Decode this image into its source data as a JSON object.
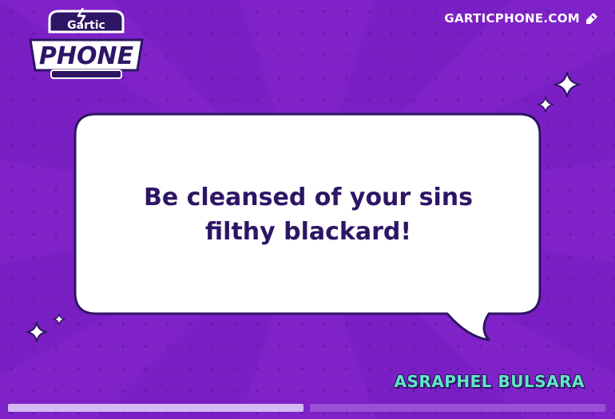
{
  "brand": {
    "logo_top": "Gartic",
    "logo_bottom": "PHONE",
    "site_link": "GARTICPHONE.COM"
  },
  "icons": {
    "site_link_icon": "edit-pencil-icon",
    "sparkles": "sparkle-icon"
  },
  "round": {
    "message": "Be cleansed of your sins filthy blackard!",
    "author": "ASRAPHEL BULSARA"
  },
  "progress": {
    "segments": [
      {
        "state": "done"
      },
      {
        "state": "todo"
      }
    ]
  },
  "colors": {
    "background": "#7a1fc4",
    "dots": "#6a16b0",
    "bubble_fill": "#ffffff",
    "bubble_outline": "#2e1565",
    "text": "#2e1565",
    "author": "#62e6c6",
    "progress_done": "#d6b8f2",
    "progress_todo": "#9a4fd6"
  }
}
